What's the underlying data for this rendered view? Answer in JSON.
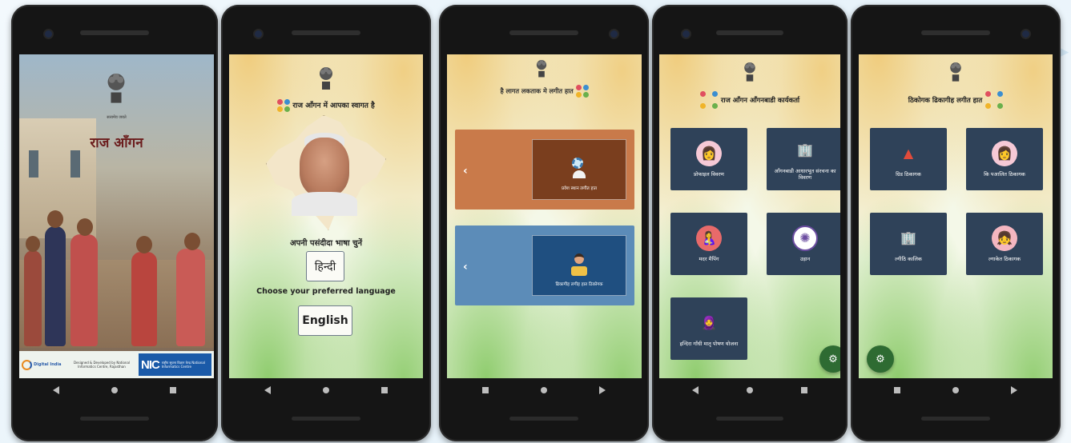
{
  "screen1": {
    "motto": "सत्यमेव जयते",
    "app_title": "राज आँगन",
    "digital_india": "Digital India",
    "designed_by": "Designed & Developed by National Informatics Centre, Rajasthan",
    "nic_logo": "NIC",
    "nic_text": "राष्ट्रीय सूचना विज्ञान केन्द्र National Informatics Centre"
  },
  "screen2": {
    "welcome": "राज आँगन में आपका स्वागत है",
    "choose_hindi": "अपनी पसंदीदा भाषा चुनें",
    "hindi_button": "हिन्दी",
    "choose_english": "Choose your preferred language",
    "english_button": "English"
  },
  "screen3": {
    "header": "है लागत लकताक मे लगीत हात",
    "card1_label": "प्रवेश स्थान लगीत हात",
    "card2_label": "ढिकागीह लगीह हात ठिकोगक",
    "colors": {
      "card1": "#c97a4a",
      "card2": "#5c8cb8"
    }
  },
  "screen4": {
    "header": "राज आँगन आँगनबाडी कार्यकर्ता",
    "tiles": [
      {
        "label": "प्रोफाइल विवरण",
        "icon": "profile-icon"
      },
      {
        "label": "आँगनबाडी आधारभूत संरचना का विवरण",
        "icon": "building-icon"
      },
      {
        "label": "मदर मैपिंग",
        "icon": "mother-icon"
      },
      {
        "label": "उड़ान",
        "icon": "udaan-icon"
      },
      {
        "label": "इन्दिरा गाँधी मातृ पोषण योजना",
        "icon": "woman-icon"
      }
    ]
  },
  "screen5": {
    "header": "ठिकोगक ढिकागीह लगीत हात",
    "tiles": [
      {
        "label": "ग्रिड ठिकागक",
        "icon": "triangle-icon"
      },
      {
        "label": "कि पआलित ठिकागक",
        "icon": "profile-icon"
      },
      {
        "label": "ल्गीठि कालिक",
        "icon": "building-icon"
      },
      {
        "label": "ल्गाकेत ठिकागक",
        "icon": "girl-icon"
      }
    ]
  },
  "colors": {
    "tile_bg": "#2f4259",
    "fab_green": "#2e6b32"
  }
}
